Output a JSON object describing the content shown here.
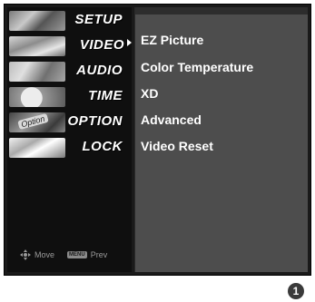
{
  "menu": {
    "items": [
      {
        "label": "SETUP",
        "icon": "setup-photo-icon",
        "selected": false
      },
      {
        "label": "VIDEO",
        "icon": "video-photo-icon",
        "selected": true
      },
      {
        "label": "AUDIO",
        "icon": "audio-photo-icon",
        "selected": false
      },
      {
        "label": "TIME",
        "icon": "time-photo-icon",
        "selected": false
      },
      {
        "label": "OPTION",
        "icon": "option-photo-icon",
        "selected": false
      },
      {
        "label": "LOCK",
        "icon": "lock-photo-icon",
        "selected": false
      }
    ],
    "option_tag": "Option"
  },
  "hint": {
    "move_label": "Move",
    "menu_key": "MENU",
    "prev_label": "Prev"
  },
  "submenu": {
    "items": [
      {
        "label": "EZ Picture"
      },
      {
        "label": "Color Temperature"
      },
      {
        "label": "XD"
      },
      {
        "label": "Advanced"
      },
      {
        "label": "Video Reset"
      }
    ]
  },
  "step_badge": "1",
  "colors": {
    "osd_background": "#1a1a1a",
    "submenu_background": "#4d4d4d",
    "text": "#ffffff",
    "hint_text": "#9a9a9a"
  }
}
